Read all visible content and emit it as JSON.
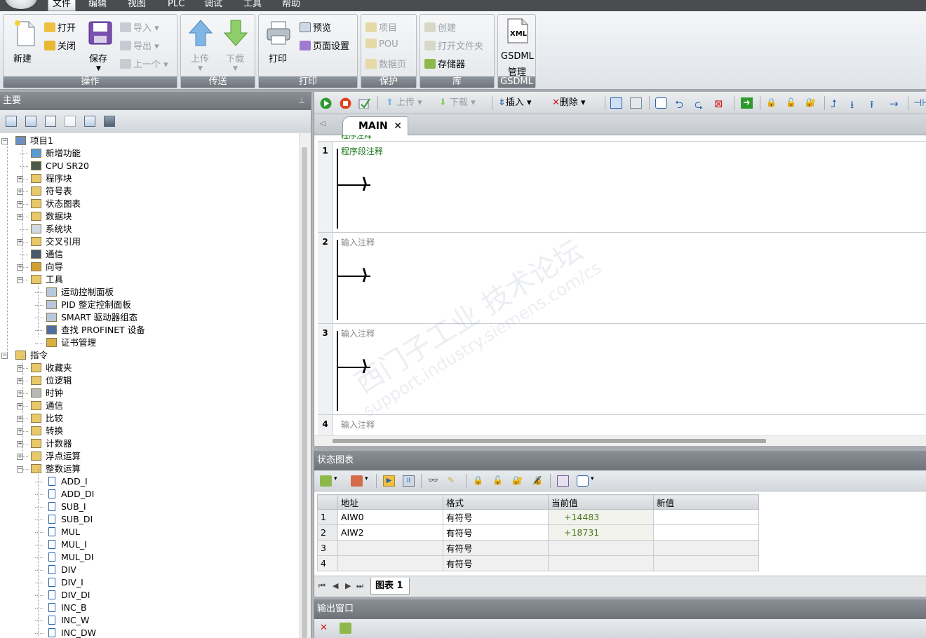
{
  "menu": {
    "items": [
      "文件",
      "编辑",
      "视图",
      "PLC",
      "调试",
      "工具",
      "帮助"
    ],
    "active": "文件"
  },
  "ribbon": {
    "groups": {
      "operation": {
        "title": "操作",
        "new": "新建",
        "open": "打开",
        "close": "关闭",
        "save": "保存",
        "import": "导入",
        "export": "导出",
        "previous": "上一个"
      },
      "transfer": {
        "title": "传送",
        "upload": "上传",
        "download": "下载"
      },
      "print": {
        "title": "打印",
        "print": "打印",
        "preview": "预览",
        "page_setup": "页面设置"
      },
      "protect": {
        "title": "保护",
        "project": "项目",
        "pou": "POU",
        "data_page": "数据页"
      },
      "library": {
        "title": "库",
        "create": "创建",
        "open_folder": "打开文件夹",
        "memory": "存储器"
      },
      "gsdml": {
        "title": "GSDML",
        "label1": "GSDML",
        "label2": "管理",
        "icon_text": "XML"
      }
    }
  },
  "left_panel": {
    "title": "主要",
    "tree": [
      {
        "label": "项目1",
        "level": 0,
        "expander": "-",
        "icon": "project-icon"
      },
      {
        "label": "新增功能",
        "level": 1,
        "expander": "",
        "icon": "help-icon"
      },
      {
        "label": "CPU SR20",
        "level": 1,
        "expander": "",
        "icon": "cpu-icon"
      },
      {
        "label": "程序块",
        "level": 1,
        "expander": "+",
        "icon": "folder-icon"
      },
      {
        "label": "符号表",
        "level": 1,
        "expander": "+",
        "icon": "folder-icon"
      },
      {
        "label": "状态图表",
        "level": 1,
        "expander": "+",
        "icon": "folder-icon"
      },
      {
        "label": "数据块",
        "level": 1,
        "expander": "+",
        "icon": "folder-icon"
      },
      {
        "label": "系统块",
        "level": 1,
        "expander": "",
        "icon": "system-block-icon"
      },
      {
        "label": "交叉引用",
        "level": 1,
        "expander": "+",
        "icon": "folder-icon"
      },
      {
        "label": "通信",
        "level": 1,
        "expander": "",
        "icon": "communication-icon"
      },
      {
        "label": "向导",
        "level": 1,
        "expander": "+",
        "icon": "wizard-icon"
      },
      {
        "label": "工具",
        "level": 1,
        "expander": "-",
        "icon": "folder-icon"
      },
      {
        "label": "运动控制面板",
        "level": 2,
        "expander": "",
        "icon": "panel-icon"
      },
      {
        "label": "PID 整定控制面板",
        "level": 2,
        "expander": "",
        "icon": "panel-icon"
      },
      {
        "label": "SMART 驱动器组态",
        "level": 2,
        "expander": "",
        "icon": "panel-icon"
      },
      {
        "label": "查找 PROFINET 设备",
        "level": 2,
        "expander": "",
        "icon": "network-icon"
      },
      {
        "label": "证书管理",
        "level": 2,
        "expander": "",
        "icon": "certificate-icon"
      },
      {
        "label": "指令",
        "level": 0,
        "expander": "-",
        "icon": "instructions-icon"
      },
      {
        "label": "收藏夹",
        "level": 1,
        "expander": "+",
        "icon": "folder-icon"
      },
      {
        "label": "位逻辑",
        "level": 1,
        "expander": "+",
        "icon": "folder-icon"
      },
      {
        "label": "时钟",
        "level": 1,
        "expander": "+",
        "icon": "clock-icon"
      },
      {
        "label": "通信",
        "level": 1,
        "expander": "+",
        "icon": "folder-icon"
      },
      {
        "label": "比较",
        "level": 1,
        "expander": "+",
        "icon": "folder-icon"
      },
      {
        "label": "转换",
        "level": 1,
        "expander": "+",
        "icon": "folder-icon"
      },
      {
        "label": "计数器",
        "level": 1,
        "expander": "+",
        "icon": "folder-icon"
      },
      {
        "label": "浮点运算",
        "level": 1,
        "expander": "+",
        "icon": "folder-icon"
      },
      {
        "label": "整数运算",
        "level": 1,
        "expander": "-",
        "icon": "folder-icon"
      },
      {
        "label": "ADD_I",
        "level": 2,
        "expander": "",
        "icon": "instruction-icon"
      },
      {
        "label": "ADD_DI",
        "level": 2,
        "expander": "",
        "icon": "instruction-icon"
      },
      {
        "label": "SUB_I",
        "level": 2,
        "expander": "",
        "icon": "instruction-icon"
      },
      {
        "label": "SUB_DI",
        "level": 2,
        "expander": "",
        "icon": "instruction-icon"
      },
      {
        "label": "MUL",
        "level": 2,
        "expander": "",
        "icon": "instruction-icon"
      },
      {
        "label": "MUL_I",
        "level": 2,
        "expander": "",
        "icon": "instruction-icon"
      },
      {
        "label": "MUL_DI",
        "level": 2,
        "expander": "",
        "icon": "instruction-icon"
      },
      {
        "label": "DIV",
        "level": 2,
        "expander": "",
        "icon": "instruction-icon"
      },
      {
        "label": "DIV_I",
        "level": 2,
        "expander": "",
        "icon": "instruction-icon"
      },
      {
        "label": "DIV_DI",
        "level": 2,
        "expander": "",
        "icon": "instruction-icon"
      },
      {
        "label": "INC_B",
        "level": 2,
        "expander": "",
        "icon": "instruction-icon"
      },
      {
        "label": "INC_W",
        "level": 2,
        "expander": "",
        "icon": "instruction-icon"
      },
      {
        "label": "INC_DW",
        "level": 2,
        "expander": "",
        "icon": "instruction-icon"
      }
    ]
  },
  "editor": {
    "toolbar": {
      "upload": "上传",
      "download": "下载",
      "insert": "插入",
      "delete": "删除"
    },
    "tab": "MAIN",
    "top_comment": "程序注释",
    "networks": [
      {
        "number": "1",
        "comment": "程序段注释"
      },
      {
        "number": "2",
        "comment": "输入注释"
      },
      {
        "number": "3",
        "comment": "输入注释"
      },
      {
        "number": "4",
        "comment": "输入注释"
      }
    ],
    "watermark": "西门子工业 技术论坛",
    "watermark_url": "support.industry.siemens.com/cs"
  },
  "status_chart": {
    "title": "状态图表",
    "columns": [
      "地址",
      "格式",
      "当前值",
      "新值"
    ],
    "rows": [
      {
        "num": "1",
        "address": "AIW0",
        "format": "有符号",
        "current": "+14483",
        "new": ""
      },
      {
        "num": "2",
        "address": "AIW2",
        "format": "有符号",
        "current": "+18731",
        "new": ""
      },
      {
        "num": "3",
        "address": "",
        "format": "有符号",
        "current": "",
        "new": ""
      },
      {
        "num": "4",
        "address": "",
        "format": "有符号",
        "current": "",
        "new": ""
      }
    ],
    "sheet_tab": "图表 1"
  },
  "output_window": {
    "title": "输出窗口"
  }
}
